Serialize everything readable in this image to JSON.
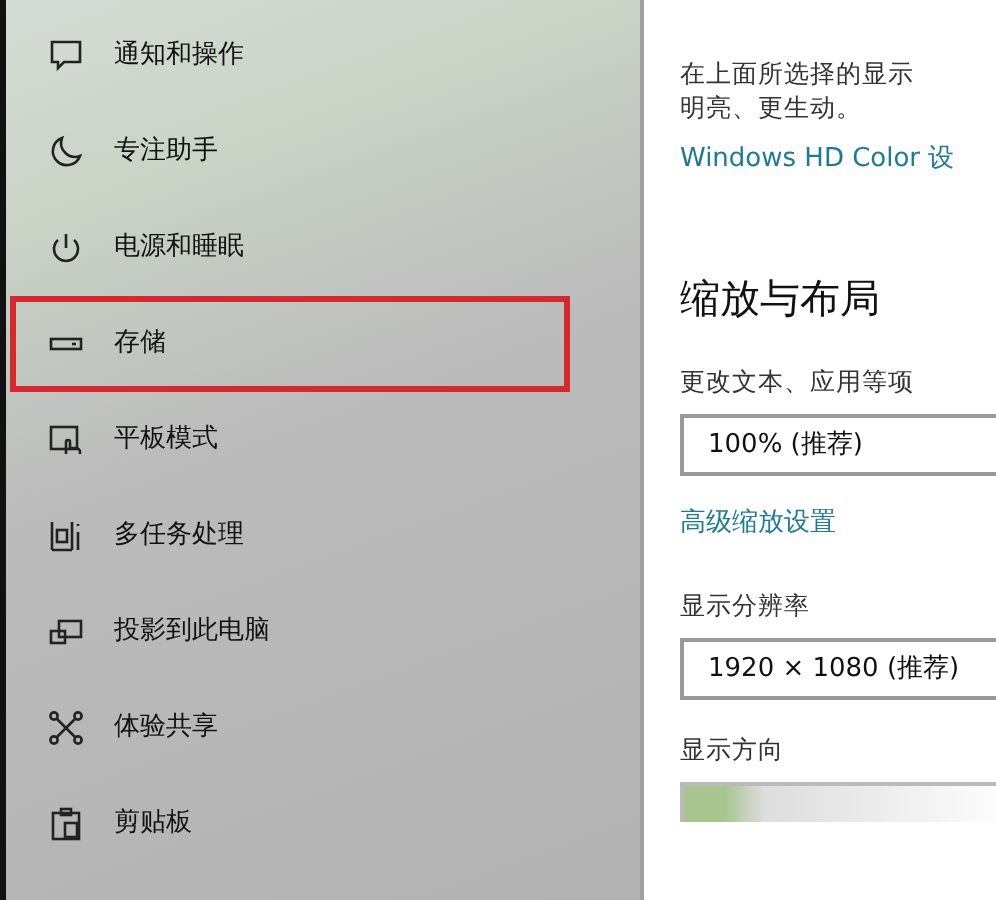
{
  "sidebar": {
    "items": [
      {
        "label": "通知和操作",
        "highlighted": false
      },
      {
        "label": "专注助手",
        "highlighted": false
      },
      {
        "label": "电源和睡眠",
        "highlighted": false
      },
      {
        "label": "存储",
        "highlighted": true
      },
      {
        "label": "平板模式",
        "highlighted": false
      },
      {
        "label": "多任务处理",
        "highlighted": false
      },
      {
        "label": "投影到此电脑",
        "highlighted": false
      },
      {
        "label": "体验共享",
        "highlighted": false
      },
      {
        "label": "剪贴板",
        "highlighted": false
      }
    ]
  },
  "main": {
    "hdr_description": [
      "在上面所选择的显示",
      "明亮、更生动。"
    ],
    "hdr_link": "Windows HD Color 设",
    "scale_section": {
      "heading": "缩放与布局",
      "scale_label": "更改文本、应用等项",
      "scale_value": "100% (推荐)",
      "advanced_link": "高级缩放设置",
      "resolution_label": "显示分辨率",
      "resolution_value": "1920 × 1080 (推荐)",
      "orientation_label": "显示方向"
    }
  }
}
